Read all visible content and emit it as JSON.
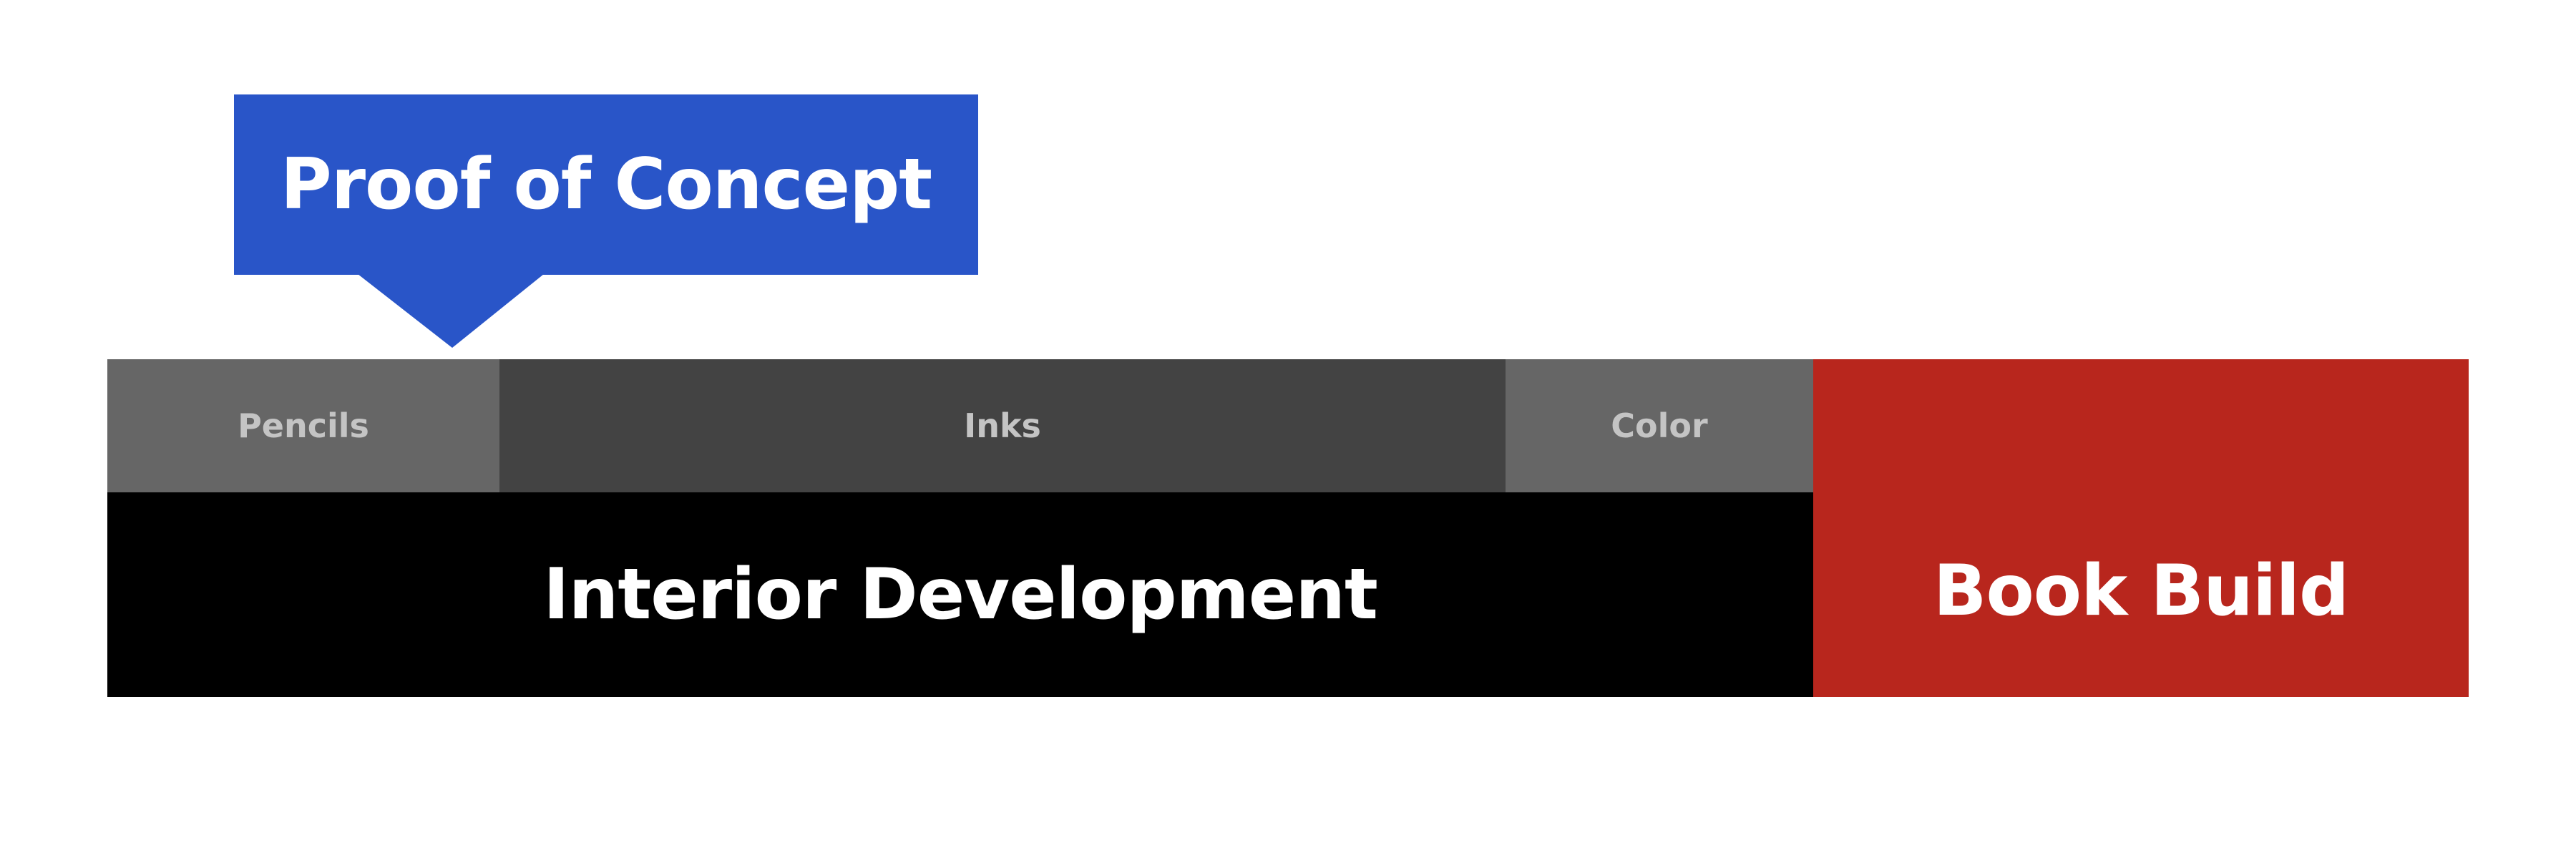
{
  "callout": {
    "label": "Proof of Concept",
    "color": "#2955c8"
  },
  "phases": [
    {
      "label": "Pencils",
      "color": "#666666"
    },
    {
      "label": "Inks",
      "color": "#434343"
    },
    {
      "label": "Color",
      "color": "#666666"
    }
  ],
  "stages": [
    {
      "label": "Interior Development",
      "color": "#000000"
    },
    {
      "label": "Book Build",
      "color": "#b8261d"
    }
  ]
}
